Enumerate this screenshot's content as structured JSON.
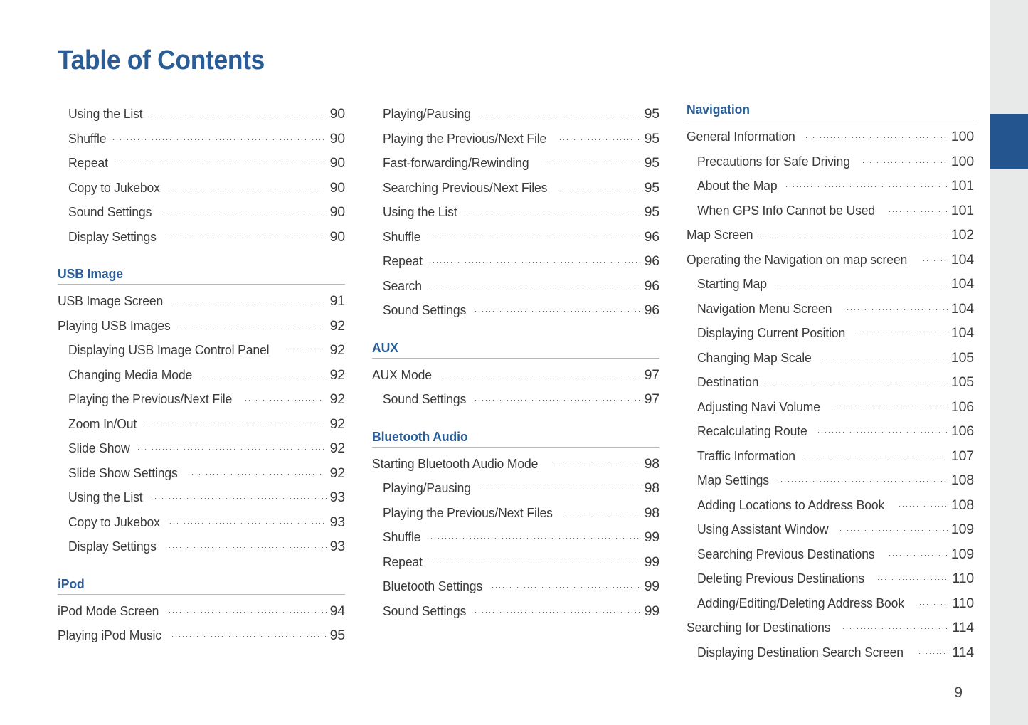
{
  "page": {
    "title": "Table of Contents",
    "folio": "9",
    "accent_blue": "#2a5c96",
    "tab_blue": "#25558f",
    "strip_gray": "#e8e9e9",
    "rule_gray": "#b8b8b8",
    "text_gray": "#3a3a3a"
  },
  "edge_tab": {
    "name": "section-thumb-tab"
  },
  "columns": [
    {
      "id": "column-1",
      "groups": [
        {
          "heading": null,
          "entries": [
            {
              "label": "Using the List",
              "page": "90",
              "level": 1
            },
            {
              "label": "Shuffle",
              "page": "90",
              "level": 1
            },
            {
              "label": "Repeat",
              "page": "90",
              "level": 1
            },
            {
              "label": "Copy to Jukebox",
              "page": "90",
              "level": 1
            },
            {
              "label": "Sound Settings",
              "page": "90",
              "level": 1
            },
            {
              "label": "Display Settings",
              "page": "90",
              "level": 1
            }
          ]
        },
        {
          "heading": "USB Image",
          "entries": [
            {
              "label": "USB Image Screen",
              "page": "91",
              "level": 0
            },
            {
              "label": "Playing USB Images",
              "page": "92",
              "level": 0
            },
            {
              "label": "Displaying USB Image Control Panel",
              "page": "92",
              "level": 1
            },
            {
              "label": "Changing Media Mode",
              "page": "92",
              "level": 1
            },
            {
              "label": "Playing the Previous/Next File",
              "page": "92",
              "level": 1
            },
            {
              "label": "Zoom In/Out",
              "page": "92",
              "level": 1
            },
            {
              "label": "Slide Show",
              "page": "92",
              "level": 1
            },
            {
              "label": "Slide Show Settings",
              "page": "92",
              "level": 1
            },
            {
              "label": "Using the List",
              "page": "93",
              "level": 1
            },
            {
              "label": "Copy to Jukebox",
              "page": "93",
              "level": 1
            },
            {
              "label": "Display Settings",
              "page": "93",
              "level": 1
            }
          ]
        },
        {
          "heading": "iPod",
          "entries": [
            {
              "label": "iPod Mode Screen",
              "page": "94",
              "level": 0
            },
            {
              "label": "Playing iPod Music",
              "page": "95",
              "level": 0
            }
          ]
        }
      ]
    },
    {
      "id": "column-2",
      "groups": [
        {
          "heading": null,
          "entries": [
            {
              "label": "Playing/Pausing",
              "page": "95",
              "level": 1
            },
            {
              "label": "Playing the Previous/Next File",
              "page": "95",
              "level": 1
            },
            {
              "label": "Fast-forwarding/Rewinding",
              "page": "95",
              "level": 1
            },
            {
              "label": "Searching Previous/Next Files",
              "page": "95",
              "level": 1
            },
            {
              "label": "Using the List",
              "page": "95",
              "level": 1
            },
            {
              "label": "Shuffle",
              "page": "96",
              "level": 1
            },
            {
              "label": "Repeat",
              "page": "96",
              "level": 1
            },
            {
              "label": "Search",
              "page": "96",
              "level": 1
            },
            {
              "label": "Sound Settings",
              "page": "96",
              "level": 1
            }
          ]
        },
        {
          "heading": "AUX",
          "entries": [
            {
              "label": "AUX Mode",
              "page": "97",
              "level": 0
            },
            {
              "label": "Sound Settings",
              "page": "97",
              "level": 1
            }
          ]
        },
        {
          "heading": "Bluetooth Audio",
          "entries": [
            {
              "label": "Starting Bluetooth Audio Mode",
              "page": "98",
              "level": 0
            },
            {
              "label": "Playing/Pausing",
              "page": "98",
              "level": 1
            },
            {
              "label": "Playing the Previous/Next Files",
              "page": "98",
              "level": 1
            },
            {
              "label": "Shuffle",
              "page": "99",
              "level": 1
            },
            {
              "label": "Repeat",
              "page": "99",
              "level": 1
            },
            {
              "label": "Bluetooth Settings",
              "page": "99",
              "level": 1
            },
            {
              "label": "Sound Settings",
              "page": "99",
              "level": 1
            }
          ]
        }
      ]
    },
    {
      "id": "column-3",
      "groups": [
        {
          "heading": "Navigation",
          "entries": [
            {
              "label": "General Information",
              "page": "100",
              "level": 0
            },
            {
              "label": "Precautions for Safe Driving",
              "page": "100",
              "level": 1
            },
            {
              "label": "About the Map",
              "page": "101",
              "level": 1
            },
            {
              "label": "When GPS Info Cannot be Used",
              "page": "101",
              "level": 1
            },
            {
              "label": "Map Screen",
              "page": "102",
              "level": 0
            },
            {
              "label": "Operating the Navigation on map screen",
              "page": "104",
              "level": 0
            },
            {
              "label": "Starting Map",
              "page": "104",
              "level": 1
            },
            {
              "label": "Navigation Menu Screen",
              "page": "104",
              "level": 1
            },
            {
              "label": "Displaying Current Position",
              "page": "104",
              "level": 1
            },
            {
              "label": "Changing Map Scale",
              "page": "105",
              "level": 1
            },
            {
              "label": "Destination",
              "page": "105",
              "level": 1
            },
            {
              "label": "Adjusting Navi Volume",
              "page": "106",
              "level": 1
            },
            {
              "label": "Recalculating Route",
              "page": "106",
              "level": 1
            },
            {
              "label": "Traffic Information",
              "page": "107",
              "level": 1
            },
            {
              "label": "Map Settings",
              "page": "108",
              "level": 1
            },
            {
              "label": "Adding Locations to Address Book",
              "page": "108",
              "level": 1
            },
            {
              "label": "Using Assistant Window",
              "page": "109",
              "level": 1
            },
            {
              "label": "Searching Previous Destinations",
              "page": "109",
              "level": 1
            },
            {
              "label": "Deleting Previous Destinations",
              "page": "110",
              "level": 1
            },
            {
              "label": "Adding/Editing/Deleting Address Book",
              "page": "110",
              "level": 1
            },
            {
              "label": "Searching for Destinations",
              "page": "114",
              "level": 0
            },
            {
              "label": "Displaying Destination Search Screen",
              "page": "114",
              "level": 1
            }
          ]
        }
      ]
    }
  ]
}
